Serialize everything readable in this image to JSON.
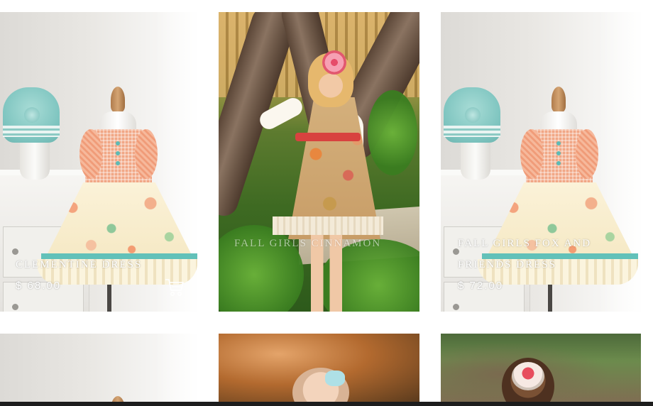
{
  "products": [
    {
      "name": "Clementine Dress",
      "price": "$ 68.00"
    },
    {
      "name": "Fall Girls Cinnamon",
      "price": ""
    },
    {
      "name": "Fall Girls Fox and Friends Dress",
      "price": "$ 72.00"
    }
  ],
  "cart_icon": "shopping-cart-icon",
  "colors": {
    "overlay_text": "#ffffff",
    "bottom_bar": "#1d1d1d"
  }
}
